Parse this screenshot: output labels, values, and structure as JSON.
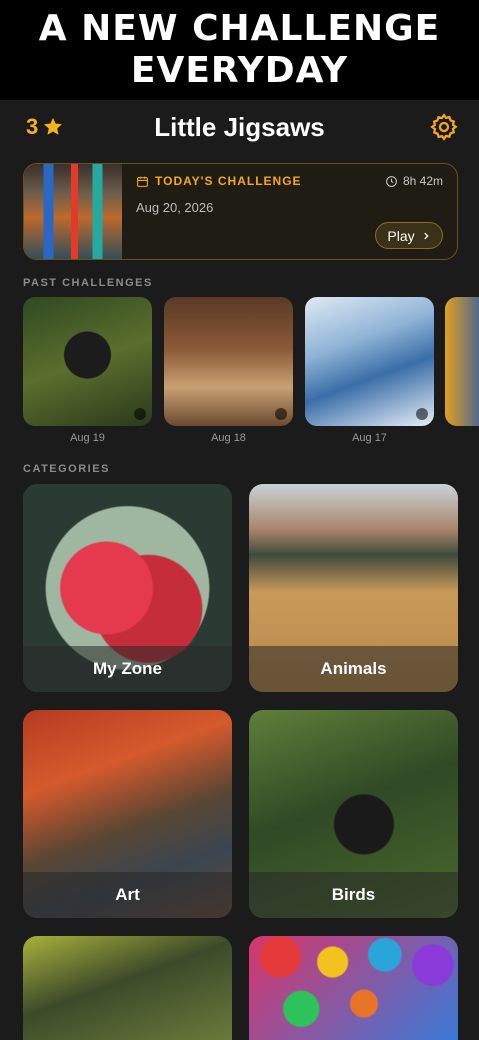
{
  "banner": {
    "line1": "A NEW CHALLENGE",
    "line2": "EVERYDAY"
  },
  "header": {
    "stars": "3",
    "title": "Little Jigsaws",
    "settings_icon": "gear-icon"
  },
  "daily": {
    "label": "TODAY'S CHALLENGE",
    "timer": "8h 42m",
    "date": "Aug 20, 2026",
    "play_label": "Play"
  },
  "past": {
    "title": "PAST CHALLENGES",
    "items": [
      {
        "date": "Aug 19"
      },
      {
        "date": "Aug 18"
      },
      {
        "date": "Aug 17"
      }
    ]
  },
  "categories": {
    "title": "CATEGORIES",
    "items": [
      {
        "label": "My Zone"
      },
      {
        "label": "Animals"
      },
      {
        "label": "Art"
      },
      {
        "label": "Birds"
      }
    ]
  },
  "colors": {
    "accent": "#f5a623",
    "background": "#1b1b1b"
  }
}
